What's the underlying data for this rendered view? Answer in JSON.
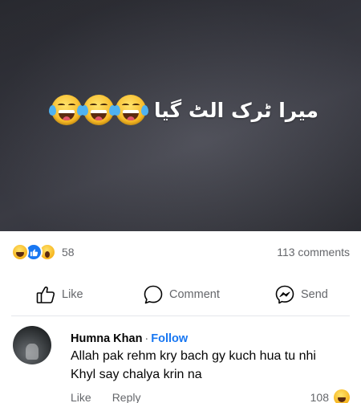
{
  "post": {
    "caption": "میرا ٹرک الٹ گیا",
    "caption_emoji_icon": "laughing-tears-emoji"
  },
  "reactions": {
    "icons": [
      "haha-reaction-icon",
      "like-reaction-icon",
      "wow-reaction-icon"
    ],
    "count": "58",
    "comments_count": "113 comments"
  },
  "actions": {
    "like_label": "Like",
    "comment_label": "Comment",
    "send_label": "Send"
  },
  "comment": {
    "author": "Humna Khan",
    "separator": "·",
    "follow_label": "Follow",
    "text": "Allah pak rehm kry bach gy kuch hua tu nhi Khyl say chalya krin na",
    "like_label": "Like",
    "reply_label": "Reply",
    "reaction_count": "108"
  },
  "colors": {
    "accent": "#1877f2",
    "secondary_text": "#65676b",
    "image_background": "#3a3b44"
  }
}
